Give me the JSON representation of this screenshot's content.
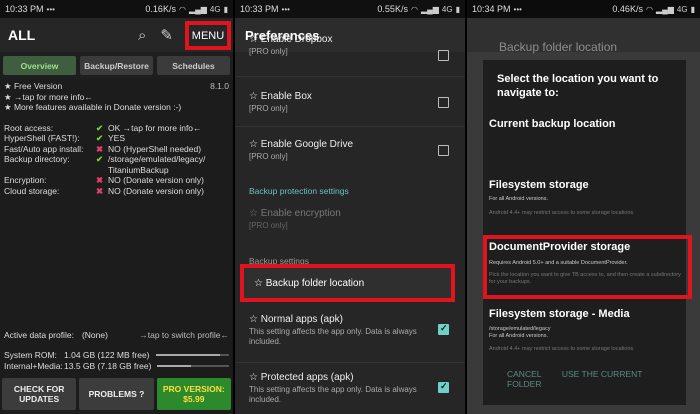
{
  "panel1": {
    "status": {
      "time": "10:33 PM",
      "speed": "0.16K/s",
      "net": "4G"
    },
    "title": "ALL",
    "menu_label": "MENU",
    "tabs": [
      "Overview",
      "Backup/Restore",
      "Schedules"
    ],
    "version_label": "★ Free Version",
    "version_value": "8.1.0",
    "info_lines": [
      "★ →tap for more info←",
      "★ More features available in Donate version :-)"
    ],
    "rows": [
      {
        "k": "Root access:",
        "mark": "ok",
        "v": "OK →tap for more info←"
      },
      {
        "k": "HyperShell (FAST!):",
        "mark": "ok",
        "v": "YES"
      },
      {
        "k": "Fast/Auto app install:",
        "mark": "no",
        "v": "NO (HyperShell needed)"
      },
      {
        "k": "Backup directory:",
        "mark": "ok",
        "v": "/storage/emulated/legacy/\nTitaniumBackup"
      },
      {
        "k": "Encryption:",
        "mark": "no",
        "v": "NO (Donate version only)"
      },
      {
        "k": "Cloud storage:",
        "mark": "no",
        "v": "NO (Donate version only)"
      }
    ],
    "profile_label": "Active data profile:",
    "profile_value": "(None)",
    "profile_hint": "→tap to switch profile←",
    "system_rom_label": "System ROM:",
    "system_rom_value": "1.04 GB (122 MB free)",
    "system_rom_used": 0.88,
    "internal_label": "Internal+Media:",
    "internal_value": "13.5 GB (7.18 GB free)",
    "internal_used": 0.47,
    "buttons": [
      "CHECK FOR UPDATES",
      "PROBLEMS ?",
      "PRO VERSION: $5.99"
    ]
  },
  "panel2": {
    "status": {
      "time": "10:33 PM",
      "speed": "0.55K/s",
      "net": "4G"
    },
    "title": "Preferences",
    "cut_item": "☆ Enable Dropbox",
    "cut_sub": "[PRO only]",
    "items": [
      {
        "t": "☆ Enable Box",
        "s": "[PRO only]"
      },
      {
        "t": "☆ Enable Google Drive",
        "s": "[PRO only]"
      }
    ],
    "section_protection": "Backup protection settings",
    "encryption_t": "☆ Enable encryption",
    "encryption_s": "[PRO only]",
    "section_backup": "Backup settings",
    "backup_folder": "☆ Backup folder location",
    "normal_t": "☆ Normal apps (apk)",
    "normal_s": "This setting affects the app only. Data is always included.",
    "protected_t": "☆ Protected apps (apk)",
    "protected_s": "This setting affects the app only. Data is always included."
  },
  "panel3": {
    "status": {
      "time": "10:34 PM",
      "speed": "0.46K/s",
      "net": "4G"
    },
    "dialog_title": "Backup folder location",
    "prompt": "Select the location you want to navigate to:",
    "current": "Current backup location",
    "fs_title": "Filesystem storage",
    "fs_sub1": "For all Android versions.",
    "fs_sub2": "Android 4.4+ may restrict access to some storage locations.",
    "doc_title": "DocumentProvider storage",
    "doc_sub1": "Requires Android 5.0+ and a suitable DocumentProvider.",
    "doc_sub2": "Pick the location you want to give TB access to, and then create a subdirectory for your backups.",
    "media_title": "Filesystem storage - Media",
    "media_sub1": "/storage/emulated/legacy",
    "media_sub2": "For all Android versions.",
    "media_sub3": "Android 4.4+ may restrict access to some storage locations.",
    "cancel": "CANCEL",
    "use_current": "USE THE CURRENT FOLDER"
  }
}
